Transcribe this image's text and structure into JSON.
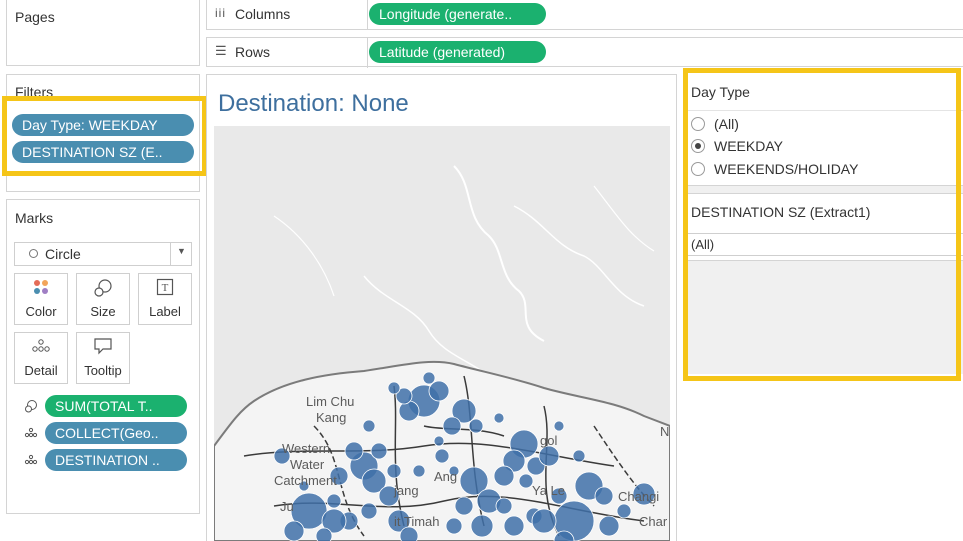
{
  "pages": {
    "title": "Pages"
  },
  "filters": {
    "title": "Filters",
    "pills": [
      "Day Type: WEEKDAY",
      "DESTINATION SZ (E.."
    ]
  },
  "marks": {
    "title": "Marks",
    "type_selected": "Circle",
    "buttons": {
      "color": "Color",
      "size": "Size",
      "label": "Label",
      "detail": "Detail",
      "tooltip": "Tooltip"
    },
    "fields": [
      "SUM(TOTAL T..",
      "COLLECT(Geo..",
      "DESTINATION .."
    ]
  },
  "shelves": {
    "columns_label": "Columns",
    "columns_pill": "Longitude (generate..",
    "rows_label": "Rows",
    "rows_pill": "Latitude (generated)"
  },
  "view": {
    "title": "Destination: None",
    "map_labels": [
      "Lim Chu",
      "Kang",
      "Western",
      "Water",
      "Catchment",
      "Ju",
      "Changi",
      "Char",
      "Ang",
      "Ya Le",
      "jang",
      "N",
      "it Timah",
      "gol"
    ]
  },
  "day_type_filter": {
    "title": "Day Type",
    "options": [
      "(All)",
      "WEEKDAY",
      "WEEKENDS/HOLIDAY"
    ],
    "selected": "WEEKDAY"
  },
  "destination_filter": {
    "title": "DESTINATION SZ (Extract1)",
    "value": "(All)"
  },
  "colors": {
    "accent_green": "#1bb16f",
    "accent_blue": "#4a8eb0",
    "highlight": "#f5c518",
    "title_blue": "#3e6f9e",
    "bubble": "#3f70a8"
  }
}
